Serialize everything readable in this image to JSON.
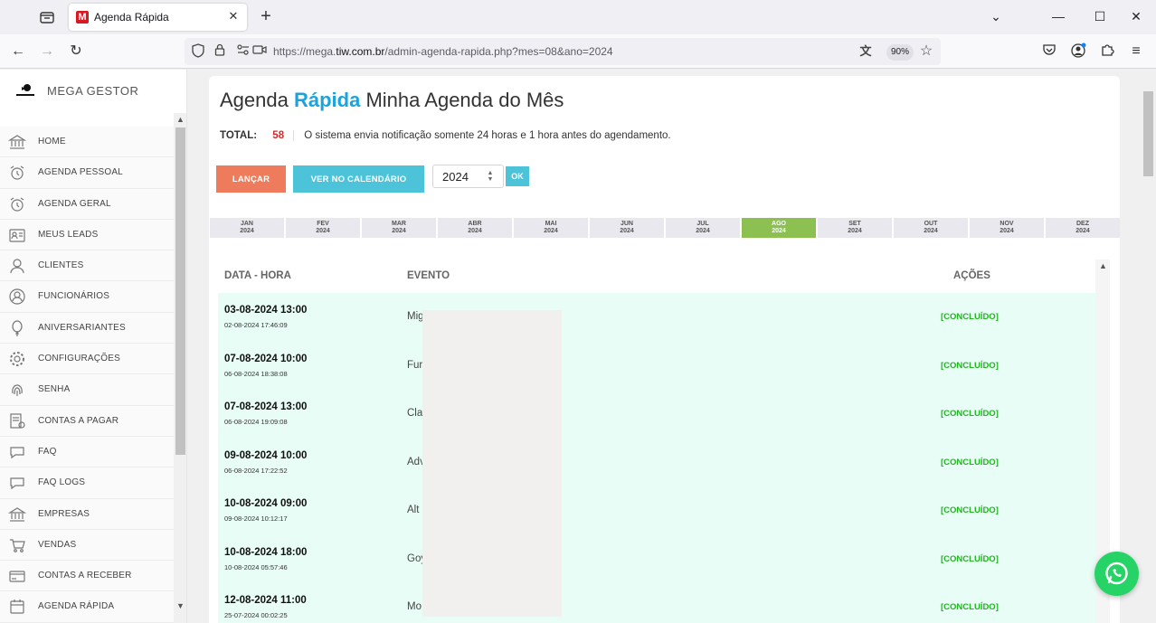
{
  "browser": {
    "tab_title": "Agenda Rápida",
    "favicon_letter": "M",
    "url_prefix": "https://mega.",
    "url_domain": "tiw.com.br",
    "url_path": "/admin-agenda-rapida.php?mes=08&ano=2024",
    "zoom": "90%"
  },
  "sidebar": {
    "brand": "MEGA GESTOR",
    "items": [
      {
        "label": "HOME",
        "icon": "bank-icon"
      },
      {
        "label": "AGENDA PESSOAL",
        "icon": "alarm-clock-icon"
      },
      {
        "label": "AGENDA GERAL",
        "icon": "alarm-clock-icon"
      },
      {
        "label": "MEUS LEADS",
        "icon": "contact-card-icon"
      },
      {
        "label": "CLIENTES",
        "icon": "user-icon"
      },
      {
        "label": "FUNCIONÁRIOS",
        "icon": "user-circle-icon"
      },
      {
        "label": "ANIVERSARIANTES",
        "icon": "balloon-icon"
      },
      {
        "label": "CONFIGURAÇÕES",
        "icon": "gear-icon"
      },
      {
        "label": "SENHA",
        "icon": "fingerprint-icon"
      },
      {
        "label": "CONTAS A PAGAR",
        "icon": "bill-icon"
      },
      {
        "label": "FAQ",
        "icon": "chat-icon"
      },
      {
        "label": "FAQ LOGS",
        "icon": "chat-icon"
      },
      {
        "label": "EMPRESAS",
        "icon": "bank-icon"
      },
      {
        "label": "VENDAS",
        "icon": "cart-icon"
      },
      {
        "label": "CONTAS A RECEBER",
        "icon": "credit-card-icon"
      },
      {
        "label": "AGENDA RÁPIDA",
        "icon": "calendar-icon"
      }
    ]
  },
  "header": {
    "title_part1": "Agenda",
    "title_accent": "Rápida",
    "title_part2": "Minha Agenda do Mês",
    "total_label": "TOTAL:",
    "total_count": "58",
    "notice": "O sistema envia notificação somente 24 horas e 1 hora antes do agendamento."
  },
  "toolbar": {
    "lancar_label": "LANÇAR",
    "calendar_label": "VER NO CALENDÁRIO",
    "year_value": "2024",
    "ok_label": "OK"
  },
  "months": [
    {
      "abbr": "JAN",
      "year": "2024"
    },
    {
      "abbr": "FEV",
      "year": "2024"
    },
    {
      "abbr": "MAR",
      "year": "2024"
    },
    {
      "abbr": "ABR",
      "year": "2024"
    },
    {
      "abbr": "MAI",
      "year": "2024"
    },
    {
      "abbr": "JUN",
      "year": "2024"
    },
    {
      "abbr": "JUL",
      "year": "2024"
    },
    {
      "abbr": "AGO",
      "year": "2024",
      "active": true
    },
    {
      "abbr": "SET",
      "year": "2024"
    },
    {
      "abbr": "OUT",
      "year": "2024"
    },
    {
      "abbr": "NOV",
      "year": "2024"
    },
    {
      "abbr": "DEZ",
      "year": "2024"
    }
  ],
  "table": {
    "headers": {
      "date": "DATA - HORA",
      "event": "EVENTO",
      "actions": "AÇÕES"
    },
    "rows": [
      {
        "datetime": "03-08-2024 13:00",
        "created": "02-08-2024 17:46:09",
        "event": "Mig",
        "status": "[CONCLUÍDO]"
      },
      {
        "datetime": "07-08-2024 10:00",
        "created": "06-08-2024 18:38:08",
        "event": "Fur",
        "status": "[CONCLUÍDO]"
      },
      {
        "datetime": "07-08-2024 13:00",
        "created": "06-08-2024 19:09:08",
        "event": "Cla",
        "status": "[CONCLUÍDO]"
      },
      {
        "datetime": "09-08-2024 10:00",
        "created": "06-08-2024 17:22:52",
        "event": "Adv",
        "status": "[CONCLUÍDO]"
      },
      {
        "datetime": "10-08-2024 09:00",
        "created": "09-08-2024 10:12:17",
        "event": "Alt",
        "status": "[CONCLUÍDO]"
      },
      {
        "datetime": "10-08-2024 18:00",
        "created": "10-08-2024 05:57:46",
        "event": "Goy",
        "status": "[CONCLUÍDO]"
      },
      {
        "datetime": "12-08-2024 11:00",
        "created": "25-07-2024 00:02:25",
        "event": "Mo",
        "status": "[CONCLUÍDO]"
      }
    ]
  },
  "colors": {
    "accent_blue": "#1ca3dc",
    "lancar": "#ee7c5c",
    "calendar_btn": "#4dc3d9",
    "active_month": "#8cc152",
    "row_bg": "#e8fdf6",
    "status_green": "#22b521",
    "total_red": "#d42a2a"
  }
}
